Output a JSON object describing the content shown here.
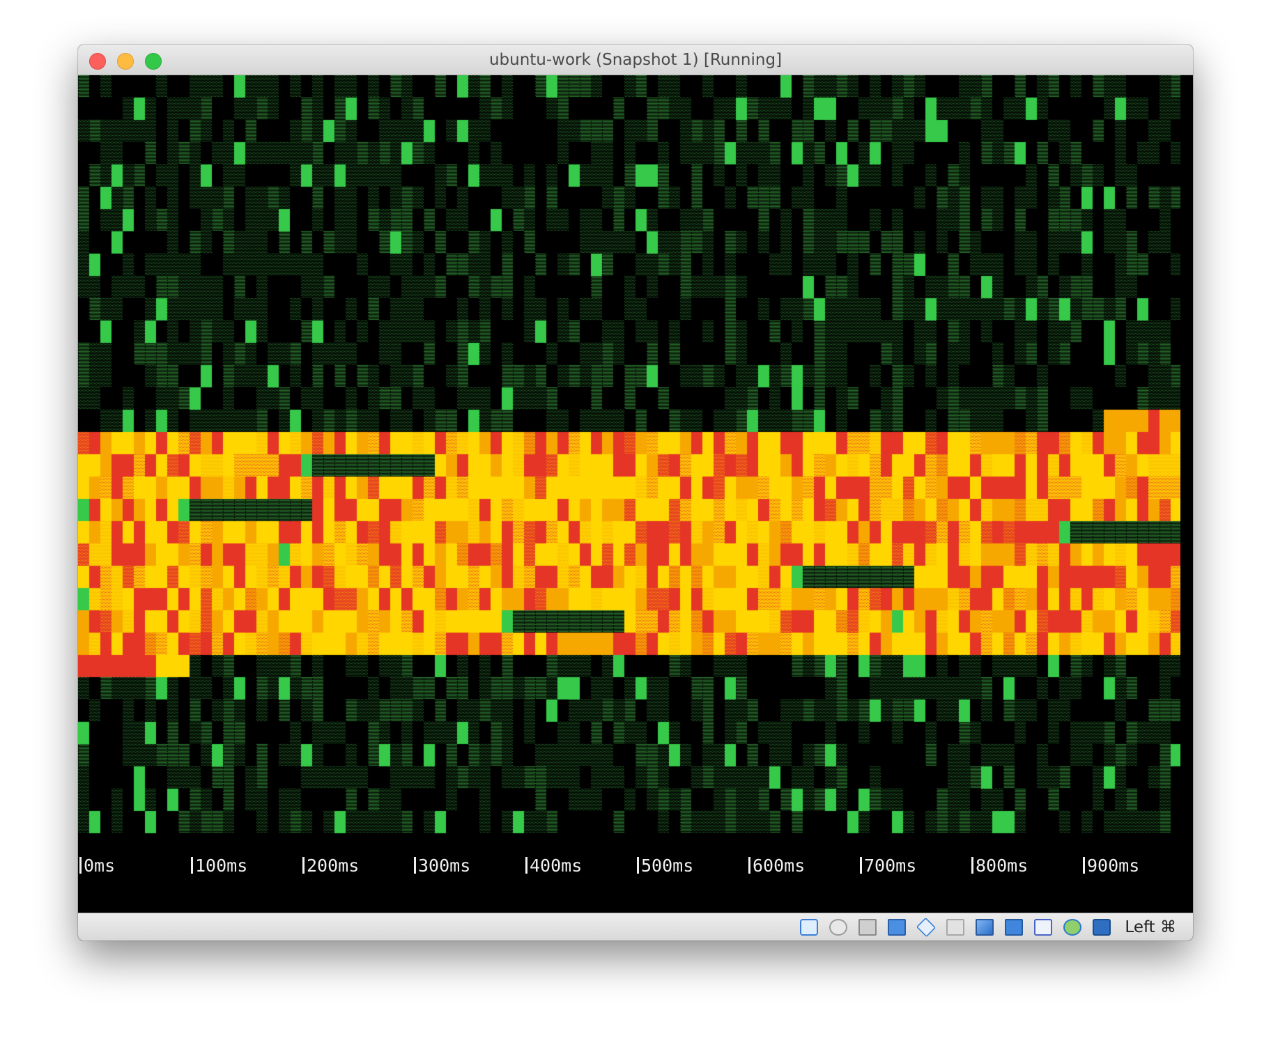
{
  "window": {
    "title": "ubuntu-work (Snapshot 1) [Running]"
  },
  "screen": {
    "axis_ticks": [
      "0ms",
      "100ms",
      "200ms",
      "300ms",
      "400ms",
      "500ms",
      "600ms",
      "700ms",
      "800ms",
      "900ms"
    ]
  },
  "statusbar": {
    "icons": [
      "hard-disk-icon",
      "optical-drive-icon",
      "audio-icon",
      "network-icon",
      "usb-icon",
      "shared-folders-icon",
      "display-icon",
      "video-capture-icon",
      "cpu-virtualization-icon",
      "mouse-integration-icon",
      "keyboard-capture-icon"
    ],
    "host_key": "Left ⌘"
  },
  "colors": {
    "green_dim": "#2e7d32",
    "green_bright": "#36c94a",
    "yellow": "#ffd600",
    "orange": "#f7a800",
    "red": "#e53527"
  }
}
